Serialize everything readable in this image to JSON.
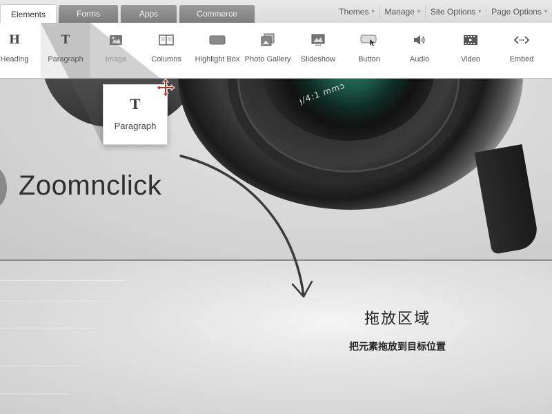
{
  "tabs": [
    {
      "label": "Elements",
      "active": true
    },
    {
      "label": "Forms",
      "active": false
    },
    {
      "label": "Apps",
      "active": false
    },
    {
      "label": "Commerce",
      "active": false
    }
  ],
  "menu": [
    {
      "label": "Themes"
    },
    {
      "label": "Manage"
    },
    {
      "label": "Site Options"
    },
    {
      "label": "Page Options"
    }
  ],
  "toolbar": {
    "items": [
      {
        "label": "Heading",
        "icon": "heading-icon"
      },
      {
        "label": "Paragraph",
        "icon": "paragraph-icon"
      },
      {
        "label": "Image",
        "icon": "image-icon"
      },
      {
        "label": "Columns",
        "icon": "columns-icon"
      },
      {
        "label": "Highlight Box",
        "icon": "highlight-box-icon"
      },
      {
        "label": "Photo Gallery",
        "icon": "photo-gallery-icon"
      },
      {
        "label": "Slideshow",
        "icon": "slideshow-icon"
      },
      {
        "label": "Button",
        "icon": "button-icon"
      },
      {
        "label": "Audio",
        "icon": "audio-icon"
      },
      {
        "label": "Video",
        "icon": "video-icon"
      },
      {
        "label": "Embed",
        "icon": "embed-icon"
      }
    ],
    "heading_glyph": "H",
    "paragraph_glyph": "T"
  },
  "drag": {
    "label": "Paragraph",
    "glyph": "T"
  },
  "site": {
    "title": "Zoomnclick",
    "lens_text": "ɟ/4:1 mmɔ"
  },
  "dropzone": {
    "title": "拖放区域",
    "subtitle": "把元素拖放到目标位置"
  },
  "colors": {
    "tab_inactive": "#8a8a8a",
    "toolbar_bg": "#ffffff",
    "cursor_red": "#b3322a"
  }
}
